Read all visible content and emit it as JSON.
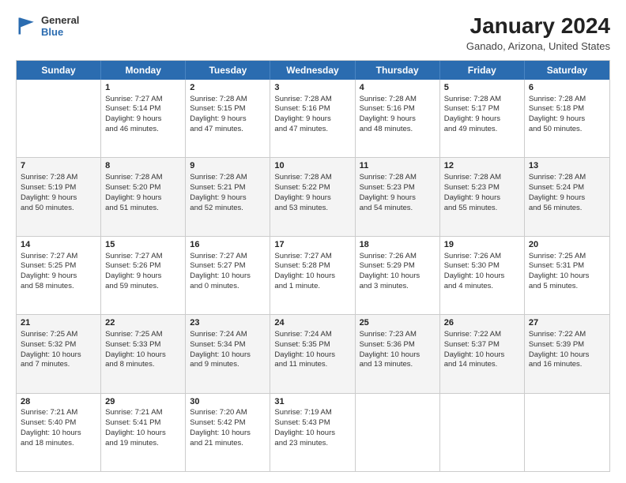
{
  "header": {
    "logo_line1": "General",
    "logo_line2": "Blue",
    "title": "January 2024",
    "subtitle": "Ganado, Arizona, United States"
  },
  "days_of_week": [
    "Sunday",
    "Monday",
    "Tuesday",
    "Wednesday",
    "Thursday",
    "Friday",
    "Saturday"
  ],
  "weeks": [
    [
      {
        "day": "",
        "info": ""
      },
      {
        "day": "1",
        "info": "Sunrise: 7:27 AM\nSunset: 5:14 PM\nDaylight: 9 hours\nand 46 minutes."
      },
      {
        "day": "2",
        "info": "Sunrise: 7:28 AM\nSunset: 5:15 PM\nDaylight: 9 hours\nand 47 minutes."
      },
      {
        "day": "3",
        "info": "Sunrise: 7:28 AM\nSunset: 5:16 PM\nDaylight: 9 hours\nand 47 minutes."
      },
      {
        "day": "4",
        "info": "Sunrise: 7:28 AM\nSunset: 5:16 PM\nDaylight: 9 hours\nand 48 minutes."
      },
      {
        "day": "5",
        "info": "Sunrise: 7:28 AM\nSunset: 5:17 PM\nDaylight: 9 hours\nand 49 minutes."
      },
      {
        "day": "6",
        "info": "Sunrise: 7:28 AM\nSunset: 5:18 PM\nDaylight: 9 hours\nand 50 minutes."
      }
    ],
    [
      {
        "day": "7",
        "info": "Sunrise: 7:28 AM\nSunset: 5:19 PM\nDaylight: 9 hours\nand 50 minutes."
      },
      {
        "day": "8",
        "info": "Sunrise: 7:28 AM\nSunset: 5:20 PM\nDaylight: 9 hours\nand 51 minutes."
      },
      {
        "day": "9",
        "info": "Sunrise: 7:28 AM\nSunset: 5:21 PM\nDaylight: 9 hours\nand 52 minutes."
      },
      {
        "day": "10",
        "info": "Sunrise: 7:28 AM\nSunset: 5:22 PM\nDaylight: 9 hours\nand 53 minutes."
      },
      {
        "day": "11",
        "info": "Sunrise: 7:28 AM\nSunset: 5:23 PM\nDaylight: 9 hours\nand 54 minutes."
      },
      {
        "day": "12",
        "info": "Sunrise: 7:28 AM\nSunset: 5:23 PM\nDaylight: 9 hours\nand 55 minutes."
      },
      {
        "day": "13",
        "info": "Sunrise: 7:28 AM\nSunset: 5:24 PM\nDaylight: 9 hours\nand 56 minutes."
      }
    ],
    [
      {
        "day": "14",
        "info": "Sunrise: 7:27 AM\nSunset: 5:25 PM\nDaylight: 9 hours\nand 58 minutes."
      },
      {
        "day": "15",
        "info": "Sunrise: 7:27 AM\nSunset: 5:26 PM\nDaylight: 9 hours\nand 59 minutes."
      },
      {
        "day": "16",
        "info": "Sunrise: 7:27 AM\nSunset: 5:27 PM\nDaylight: 10 hours\nand 0 minutes."
      },
      {
        "day": "17",
        "info": "Sunrise: 7:27 AM\nSunset: 5:28 PM\nDaylight: 10 hours\nand 1 minute."
      },
      {
        "day": "18",
        "info": "Sunrise: 7:26 AM\nSunset: 5:29 PM\nDaylight: 10 hours\nand 3 minutes."
      },
      {
        "day": "19",
        "info": "Sunrise: 7:26 AM\nSunset: 5:30 PM\nDaylight: 10 hours\nand 4 minutes."
      },
      {
        "day": "20",
        "info": "Sunrise: 7:25 AM\nSunset: 5:31 PM\nDaylight: 10 hours\nand 5 minutes."
      }
    ],
    [
      {
        "day": "21",
        "info": "Sunrise: 7:25 AM\nSunset: 5:32 PM\nDaylight: 10 hours\nand 7 minutes."
      },
      {
        "day": "22",
        "info": "Sunrise: 7:25 AM\nSunset: 5:33 PM\nDaylight: 10 hours\nand 8 minutes."
      },
      {
        "day": "23",
        "info": "Sunrise: 7:24 AM\nSunset: 5:34 PM\nDaylight: 10 hours\nand 9 minutes."
      },
      {
        "day": "24",
        "info": "Sunrise: 7:24 AM\nSunset: 5:35 PM\nDaylight: 10 hours\nand 11 minutes."
      },
      {
        "day": "25",
        "info": "Sunrise: 7:23 AM\nSunset: 5:36 PM\nDaylight: 10 hours\nand 13 minutes."
      },
      {
        "day": "26",
        "info": "Sunrise: 7:22 AM\nSunset: 5:37 PM\nDaylight: 10 hours\nand 14 minutes."
      },
      {
        "day": "27",
        "info": "Sunrise: 7:22 AM\nSunset: 5:39 PM\nDaylight: 10 hours\nand 16 minutes."
      }
    ],
    [
      {
        "day": "28",
        "info": "Sunrise: 7:21 AM\nSunset: 5:40 PM\nDaylight: 10 hours\nand 18 minutes."
      },
      {
        "day": "29",
        "info": "Sunrise: 7:21 AM\nSunset: 5:41 PM\nDaylight: 10 hours\nand 19 minutes."
      },
      {
        "day": "30",
        "info": "Sunrise: 7:20 AM\nSunset: 5:42 PM\nDaylight: 10 hours\nand 21 minutes."
      },
      {
        "day": "31",
        "info": "Sunrise: 7:19 AM\nSunset: 5:43 PM\nDaylight: 10 hours\nand 23 minutes."
      },
      {
        "day": "",
        "info": ""
      },
      {
        "day": "",
        "info": ""
      },
      {
        "day": "",
        "info": ""
      }
    ]
  ]
}
